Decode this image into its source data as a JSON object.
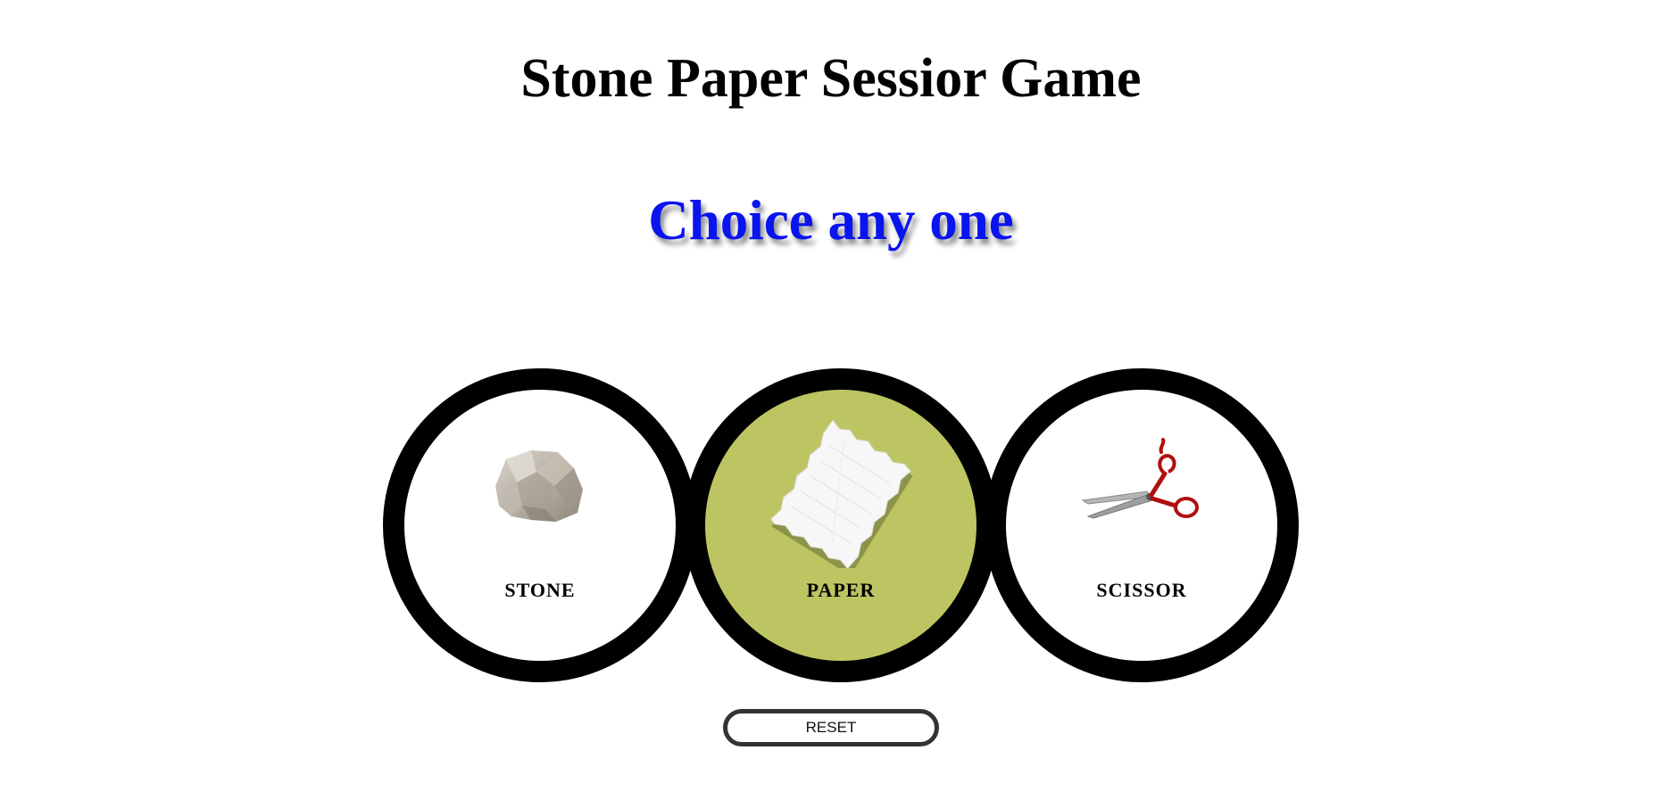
{
  "header": {
    "title": "Stone Paper Sessior Game",
    "message": "Choice any one",
    "message_color": "#0a14ee"
  },
  "choices": [
    {
      "label": "STONE",
      "icon": "stone-icon",
      "selected": false
    },
    {
      "label": "PAPER",
      "icon": "paper-icon",
      "selected": true
    },
    {
      "label": "SCISSOR",
      "icon": "scissor-icon",
      "selected": false
    }
  ],
  "colors": {
    "ring": "#000000",
    "selected_fill": "#bdc562",
    "unselected_fill": "#ffffff"
  },
  "reset": {
    "label": "RESET"
  }
}
